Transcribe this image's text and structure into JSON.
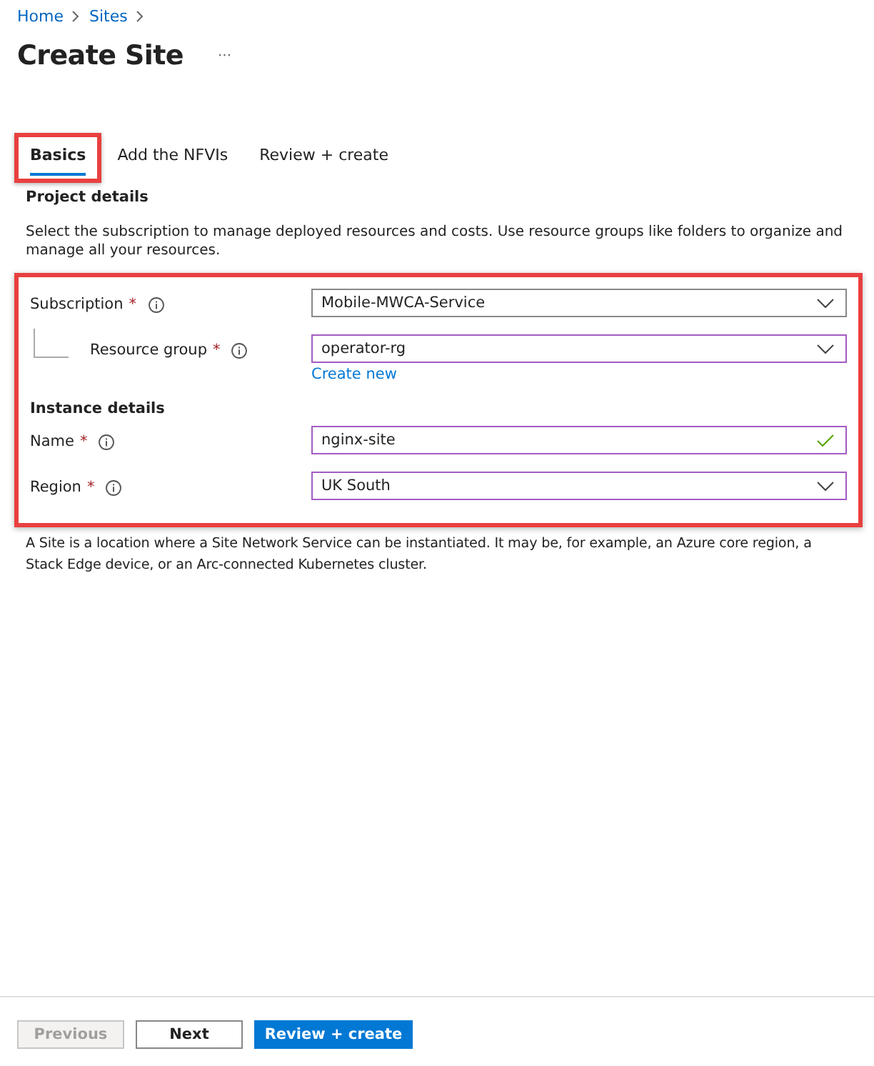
{
  "breadcrumb": [
    "Home",
    "Sites"
  ],
  "title": "Create Site",
  "more": "···",
  "tabs": [
    {
      "label": "Basics",
      "selected": true,
      "highlighted": true
    },
    {
      "label": "Add the NFVIs",
      "selected": false,
      "highlighted": false
    },
    {
      "label": "Review + create",
      "selected": false,
      "highlighted": false
    }
  ],
  "project_details": {
    "heading": "Project details",
    "description": "Select the subscription to manage deployed resources and costs. Use resource groups like folders to organize and manage all your resources."
  },
  "form": {
    "highlighted": true,
    "sections": [
      {
        "fields": [
          {
            "label": "Subscription",
            "required": "*",
            "kind": "select",
            "value": "Mobile-MWCA-Service",
            "edited": false,
            "nested": false,
            "valid": false
          },
          {
            "label": "Resource group",
            "required": "*",
            "kind": "select",
            "value": "operator-rg",
            "edited": true,
            "nested": true,
            "valid": false,
            "link": "Create new"
          }
        ]
      },
      {
        "heading": "Instance details",
        "fields": [
          {
            "label": "Name",
            "required": "*",
            "kind": "text",
            "value": "nginx-site",
            "edited": true,
            "nested": false,
            "valid": true
          },
          {
            "label": "Region",
            "required": "*",
            "kind": "select",
            "value": "UK South",
            "edited": true,
            "nested": false,
            "valid": false
          }
        ]
      }
    ]
  },
  "note": "A Site is a location where a Site Network Service can be instantiated. It may be, for example, an Azure core region, a Stack Edge device, or an Arc-connected Kubernetes cluster.",
  "footer": [
    {
      "label": "Previous",
      "kind": "secondary",
      "disabled": true
    },
    {
      "label": "Next",
      "kind": "secondary",
      "disabled": false
    },
    {
      "label": "Review + create",
      "kind": "primary",
      "disabled": false
    }
  ]
}
